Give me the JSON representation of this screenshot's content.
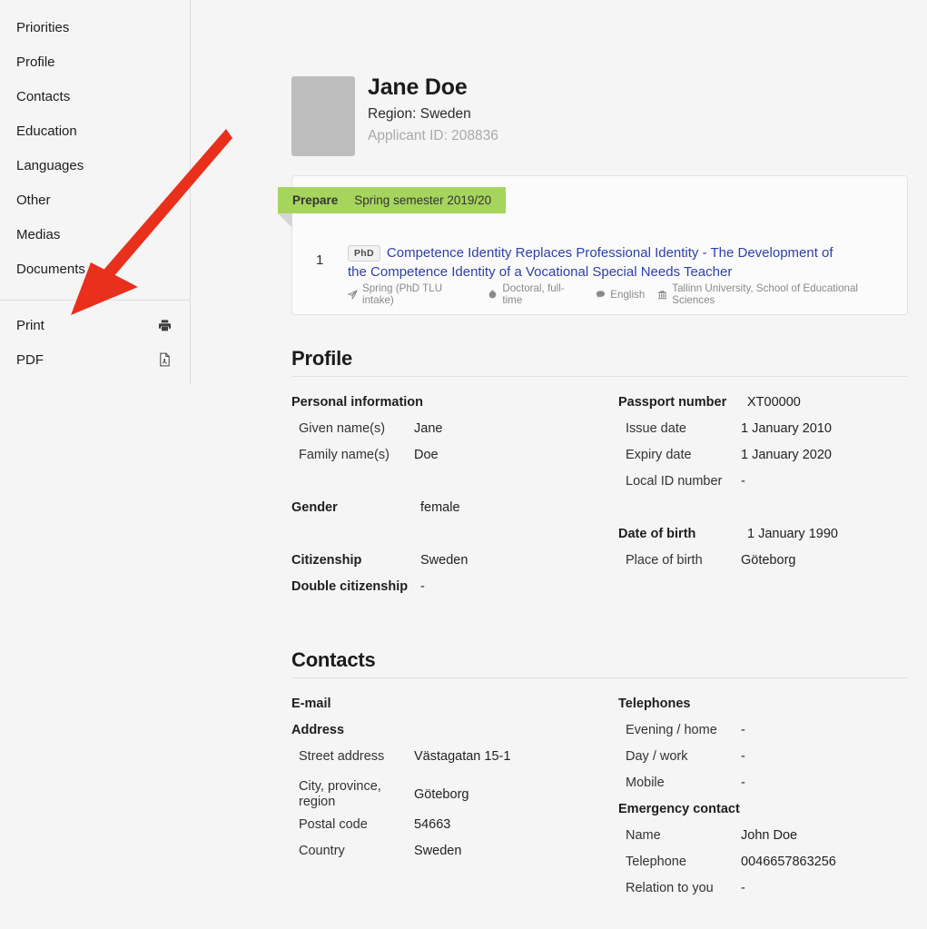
{
  "sidebar": {
    "nav_items": [
      {
        "label": "Priorities",
        "name": "priorities"
      },
      {
        "label": "Profile",
        "name": "profile"
      },
      {
        "label": "Contacts",
        "name": "contacts"
      },
      {
        "label": "Education",
        "name": "education"
      },
      {
        "label": "Languages",
        "name": "languages"
      },
      {
        "label": "Other",
        "name": "other"
      },
      {
        "label": "Medias",
        "name": "medias"
      },
      {
        "label": "Documents",
        "name": "documents"
      }
    ],
    "tools": [
      {
        "label": "Print",
        "icon": "printer-icon"
      },
      {
        "label": "PDF",
        "icon": "pdf-file-icon"
      }
    ]
  },
  "header": {
    "name": "Jane Doe",
    "region": "Region: Sweden",
    "applicant_id": "Applicant ID: 208836",
    "mail_icon": "envelope-icon"
  },
  "application_card": {
    "ribbon": {
      "status": "Prepare",
      "term": "Spring semester 2019/20",
      "color": "#a6d55d"
    },
    "index": "1",
    "degree_badge": "PhD",
    "title": "Competence Identity Replaces Professional Identity - The Development of the Competence Identity of a Vocational Special Needs Teacher",
    "title_color": "#2e3fa8",
    "meta": [
      {
        "icon": "paper-plane-icon",
        "label": "Spring (PhD TLU intake)"
      },
      {
        "icon": "circle-dot-icon",
        "label": "Doctoral, full-time"
      },
      {
        "icon": "speech-bubble-icon",
        "label": "English"
      },
      {
        "icon": "university-icon",
        "label": "Tallinn University, School of Educational Sciences"
      }
    ]
  },
  "profile_section": {
    "title": "Profile",
    "left": {
      "personal_information_header": "Personal information",
      "fields": [
        {
          "label": "Given name(s)",
          "value": "Jane"
        },
        {
          "label": "Family name(s)",
          "value": "Doe"
        }
      ],
      "gender": {
        "label": "Gender",
        "value": "female"
      },
      "citizenship": {
        "label": "Citizenship",
        "value": "Sweden"
      },
      "double_citizenship": {
        "label": "Double citizenship",
        "value": "-"
      }
    },
    "right": {
      "passport": {
        "label": "Passport number",
        "value": "XT00000"
      },
      "passport_fields": [
        {
          "label": "Issue date",
          "value": "1 January 2010"
        },
        {
          "label": "Expiry date",
          "value": "1 January 2020"
        },
        {
          "label": "Local ID number",
          "value": "-"
        }
      ],
      "date_of_birth": {
        "label": "Date of birth",
        "value": "1 January 1990"
      },
      "place_of_birth": {
        "label": "Place of birth",
        "value": "Göteborg"
      }
    }
  },
  "contacts_section": {
    "title": "Contacts",
    "left": {
      "email_header": "E-mail",
      "address_header": "Address",
      "address_fields": [
        {
          "label": "Street address",
          "value": "Västagatan 15-1"
        },
        {
          "label": "City, province, region",
          "value": "Göteborg"
        },
        {
          "label": "Postal code",
          "value": "54663"
        },
        {
          "label": "Country",
          "value": "Sweden"
        }
      ]
    },
    "right": {
      "telephones_header": "Telephones",
      "telephone_fields": [
        {
          "label": "Evening / home",
          "value": "-"
        },
        {
          "label": "Day / work",
          "value": "-"
        },
        {
          "label": "Mobile",
          "value": "-"
        }
      ],
      "emergency_header": "Emergency contact",
      "emergency_fields": [
        {
          "label": "Name",
          "value": "John Doe"
        },
        {
          "label": "Telephone",
          "value": "0046657863256"
        },
        {
          "label": "Relation to you",
          "value": "-"
        }
      ]
    }
  },
  "annotation": {
    "arrow_color": "#e8301c",
    "arrow_from": "248,146",
    "arrow_to": "79,345"
  }
}
